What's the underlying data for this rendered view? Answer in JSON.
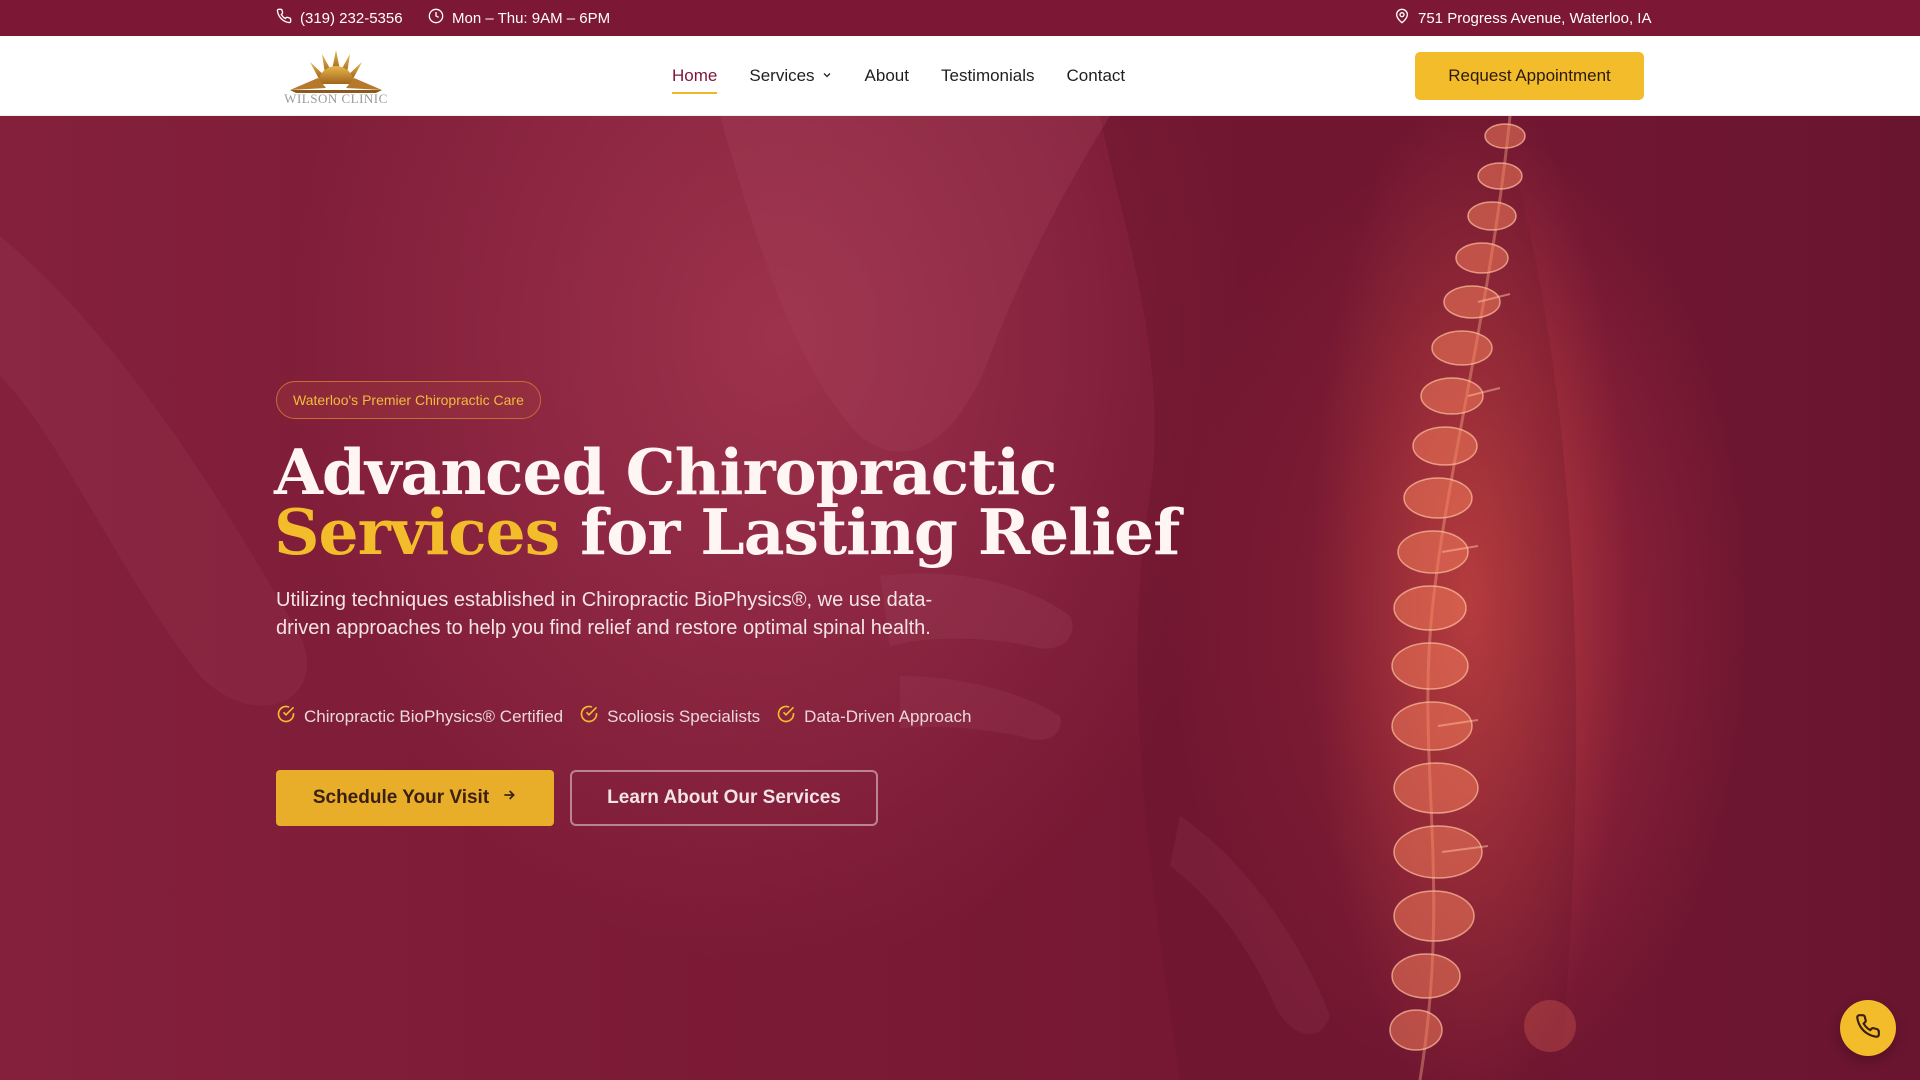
{
  "topbar": {
    "phone": "(319) 232-5356",
    "hours": "Mon – Thu: 9AM – 6PM",
    "address": "751 Progress Avenue, Waterloo, IA"
  },
  "header": {
    "logo_text": "WILSON CLINIC",
    "nav": [
      {
        "label": "Home",
        "active": true
      },
      {
        "label": "Services",
        "dropdown": true
      },
      {
        "label": "About"
      },
      {
        "label": "Testimonials"
      },
      {
        "label": "Contact"
      }
    ],
    "cta_label": "Request Appointment"
  },
  "hero": {
    "badge": "Waterloo's Premier Chiropractic Care",
    "headline_line1": "Advanced Chiropractic",
    "headline_accent": "Services",
    "headline_line2_rest": "for Lasting Relief",
    "lead": "Utilizing techniques established in Chiropractic BioPhysics®, we use data-driven approaches to help you find relief and restore optimal spinal health.",
    "features": [
      "Chiropractic BioPhysics® Certified",
      "Scoliosis Specialists",
      "Data-Driven Approach"
    ],
    "primary_button": "Schedule Your Visit",
    "secondary_button": "Learn About Our Services"
  },
  "colors": {
    "brand_maroon": "#7d1736",
    "accent_gold": "#f3bc2b",
    "white": "#ffffff"
  },
  "icons": {
    "phone": "phone-icon",
    "clock": "clock-icon",
    "location": "map-pin-icon",
    "chevron": "chevron-down-icon",
    "check": "check-circle-icon",
    "arrow": "arrow-right-icon",
    "fab": "phone-icon"
  }
}
